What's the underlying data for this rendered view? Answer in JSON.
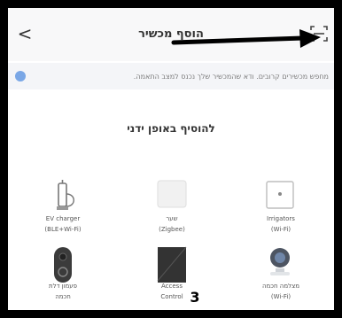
{
  "header": {
    "back_glyph": "<",
    "title": "הוסף מכשיר",
    "scan_icon": "scan-icon"
  },
  "info": {
    "text": "מחפש מכשירים קרובים. ודא שהמכשיר שלך נכנס למצב התאמה."
  },
  "manual": {
    "title": "להוסיף באופן ידני"
  },
  "devices": [
    {
      "line1": "EV charger",
      "line2": "(BLE+Wi-Fi)",
      "icon": "ev-charger-icon"
    },
    {
      "line1": "שער",
      "line2": "(Zigbee)",
      "icon": "gateway-icon"
    },
    {
      "line1": "Irrigators",
      "line2": "(Wi-Fi)",
      "icon": "irrigator-icon"
    },
    {
      "line1": "פעמון דלת",
      "line2": "חכמה",
      "icon": "doorbell-icon"
    },
    {
      "line1": "Access",
      "line2": "Control",
      "icon": "access-control-icon"
    },
    {
      "line1": "מצלמה חכמה",
      "line2": "(Wi-Fi)",
      "icon": "smart-camera-icon"
    }
  ],
  "annotation": {
    "page_number": "3",
    "arrow_color": "#000000"
  }
}
